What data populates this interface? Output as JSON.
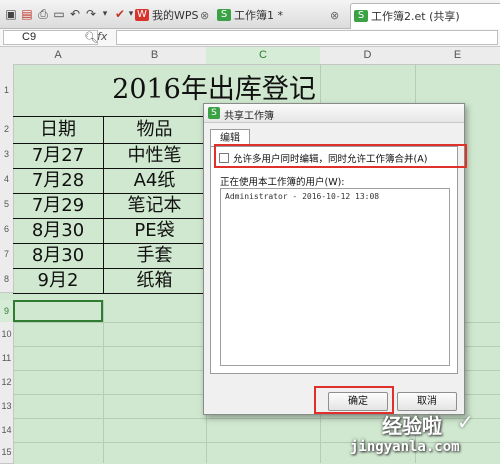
{
  "tabs": [
    {
      "label": "我的WPS",
      "icon": "wps-logo-icon",
      "color": "#d9342b"
    },
    {
      "label": "工作簿1 *",
      "icon": "spreadsheet-icon",
      "color": "#3aa144"
    },
    {
      "label": "工作簿2.et (共享)",
      "icon": "spreadsheet-icon",
      "color": "#3aa144"
    }
  ],
  "formula_bar": {
    "cell_ref": "C9",
    "fx": "fx"
  },
  "columns": [
    "A",
    "B",
    "C",
    "D",
    "E"
  ],
  "rows": [
    "1",
    "2",
    "3",
    "4",
    "5",
    "6",
    "7",
    "8",
    "9",
    "10",
    "11",
    "12",
    "13",
    "14",
    "15"
  ],
  "sheet": {
    "title": "2016年出库登记",
    "headers": [
      "日期",
      "物品"
    ],
    "data": [
      [
        "7月27",
        "中性笔"
      ],
      [
        "7月28",
        "A4纸"
      ],
      [
        "7月29",
        "笔记本"
      ],
      [
        "8月30",
        "PE袋"
      ],
      [
        "8月30",
        "手套"
      ],
      [
        "9月2",
        "纸箱"
      ]
    ]
  },
  "dialog": {
    "title": "共享工作簿",
    "tab": "编辑",
    "checkbox_label": "允许多用户同时编辑，同时允许工作簿合并(A)",
    "checkbox_checked": false,
    "users_label": "正在使用本工作簿的用户(W):",
    "users": [
      "Administrator - 2016-10-12 13:08"
    ],
    "ok": "确定",
    "cancel": "取消"
  },
  "watermark": {
    "main": "经验啦",
    "sub": "jingyanla.com"
  },
  "colors": {
    "highlight": "#e0302a",
    "sheet_bg": "#cfe8cf",
    "accent": "#3aa144"
  }
}
